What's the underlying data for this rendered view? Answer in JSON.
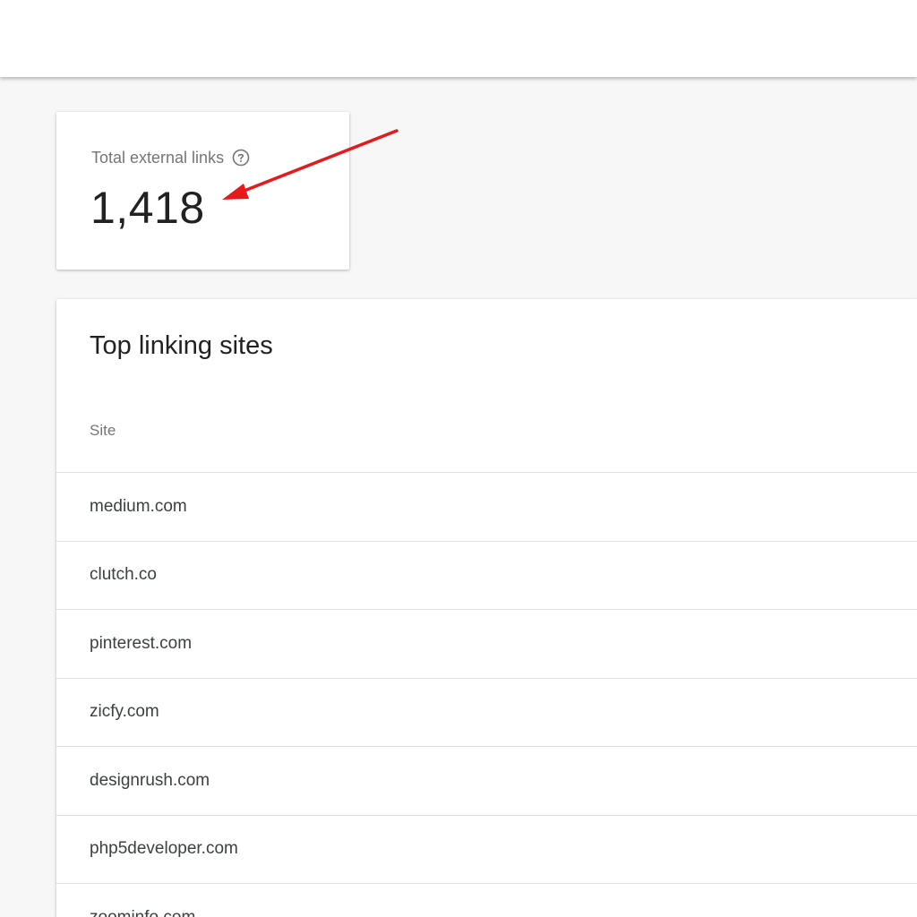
{
  "summary": {
    "label": "Total external links",
    "value": "1,418",
    "help_icon": "help-circle-icon"
  },
  "top_linking_sites": {
    "title": "Top linking sites",
    "column_header": "Site",
    "rows": [
      "medium.com",
      "clutch.co",
      "pinterest.com",
      "zicfy.com",
      "designrush.com",
      "php5developer.com",
      "zoominfo.com"
    ]
  },
  "annotation": {
    "arrow_color": "#e8191b"
  }
}
